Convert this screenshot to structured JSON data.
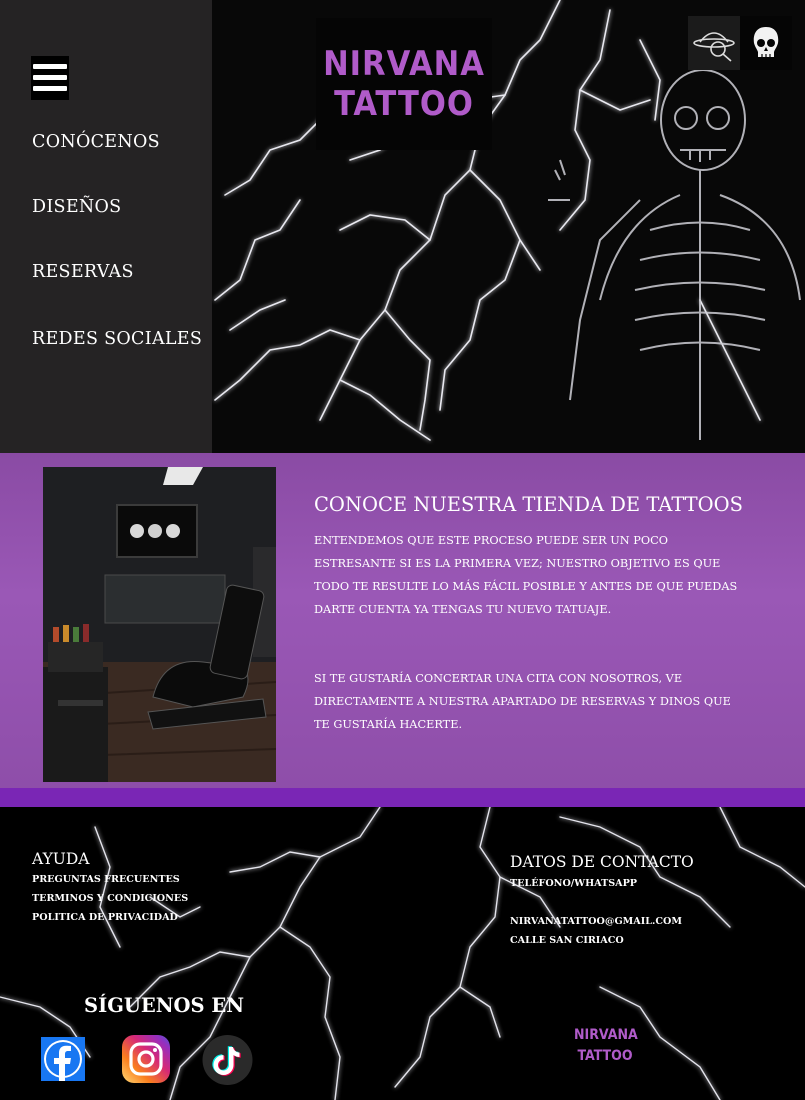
{
  "nav": {
    "menu_icon": "hamburger-menu-icon",
    "items": [
      {
        "label": "CONÓCENOS"
      },
      {
        "label": "DISEÑOS"
      },
      {
        "label": "RESERVAS"
      },
      {
        "label": "REDES SOCIALES"
      }
    ]
  },
  "logo": {
    "line1": "NIRVANA",
    "line2": "TATTOO",
    "color": "#b05bc9"
  },
  "header_icons": [
    "hat-search-icon",
    "skull-icon"
  ],
  "about": {
    "title": "CONOCE NUESTRA TIENDA DE TATTOOS",
    "paragraph1": "ENTENDEMOS QUE ESTE PROCESO PUEDE SER UN POCO ESTRESANTE SI ES LA PRIMERA VEZ; NUESTRO OBJETIVO ES QUE TODO TE RESULTE LO MÁS FÁCIL POSIBLE Y ANTES DE QUE PUEDAS DARTE CUENTA YA TENGAS TU NUEVO TATUAJE.",
    "paragraph2": "SI TE GUSTARÍA CONCERTAR UNA CITA CON NOSOTROS, VE DIRECTAMENTE A NUESTRA APARTADO DE RESERVAS Y DINOS  QUE TE GUSTARÍA HACERTE.",
    "accent": "#9a58b6"
  },
  "footer": {
    "help": {
      "title": "AYUDA",
      "links": [
        "PREGUNTAS FRECUENTES",
        "TERMINOS Y CONDICIONES",
        "POLITICA DE PRIVACIDAD"
      ]
    },
    "contact": {
      "title": "DATOS DE CONTACTO",
      "phone_label": "TELÉFONO/WHATSAPP",
      "email": "NIRVANATATTOO@GMAIL.COM",
      "address": "CALLE SAN CIRIACO"
    },
    "follow": {
      "title": "SÍGUENOS EN",
      "icons": [
        "facebook-icon",
        "instagram-icon",
        "tiktok-icon"
      ]
    },
    "logo": {
      "line1": "NIRVANA",
      "line2": "TATTOO"
    }
  }
}
